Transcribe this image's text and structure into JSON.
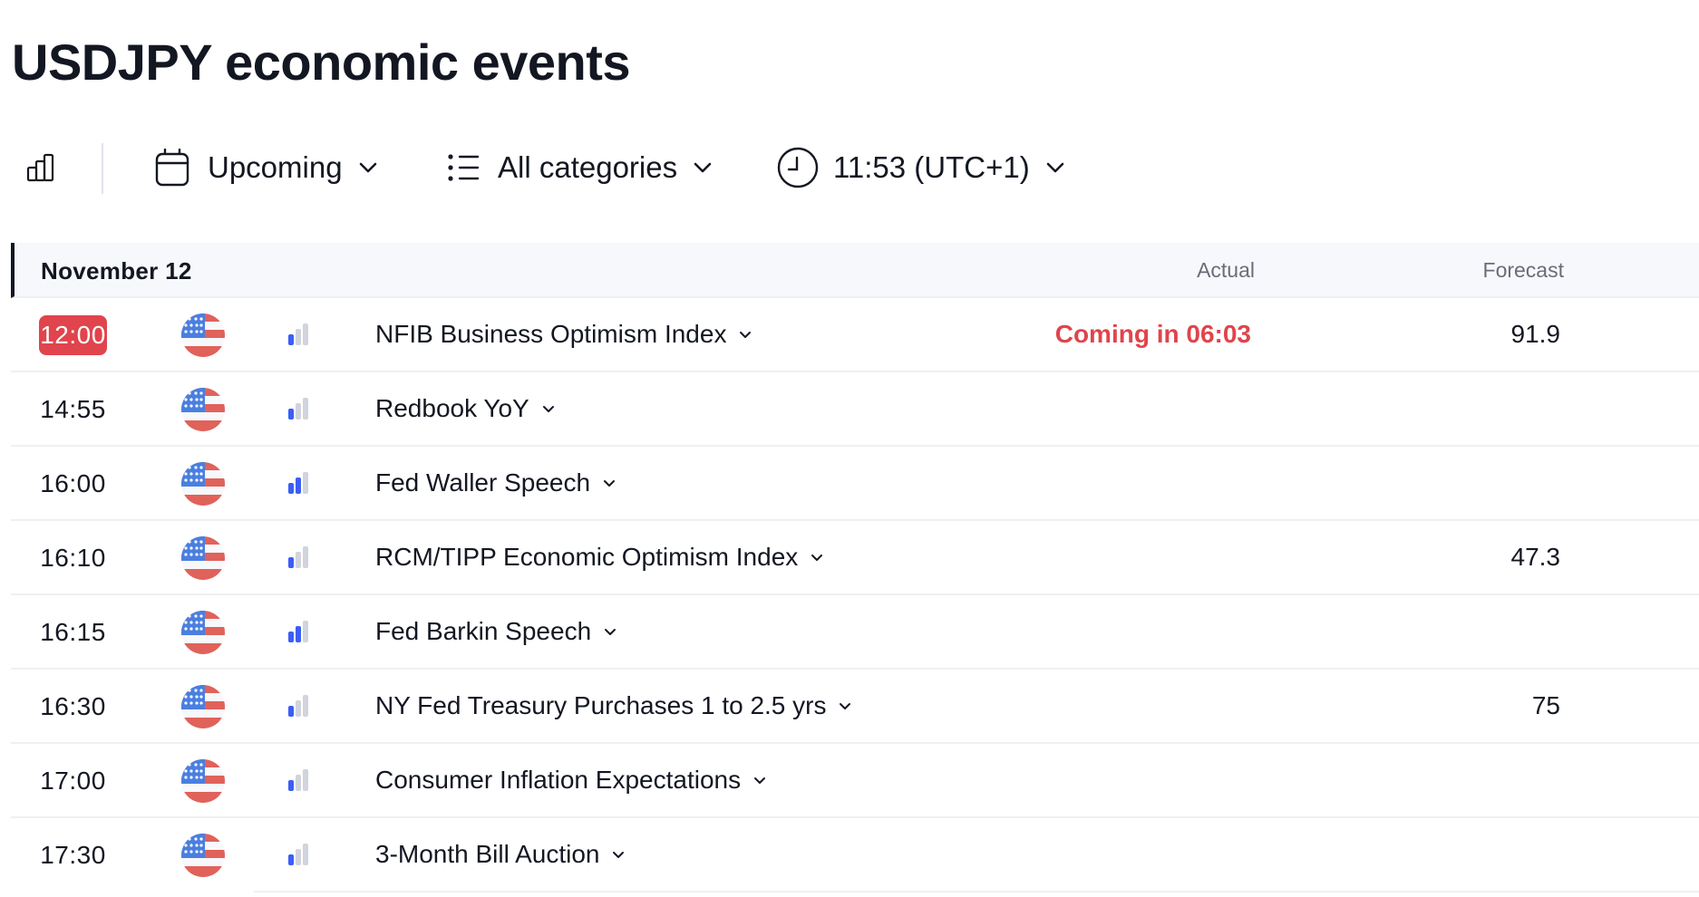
{
  "page": {
    "title": "USDJPY economic events"
  },
  "toolbar": {
    "importance_icon": "bar-chart-icon",
    "period": {
      "icon": "calendar-icon",
      "label": "Upcoming"
    },
    "categories": {
      "icon": "list-icon",
      "label": "All categories"
    },
    "timezone": {
      "icon": "clock-icon",
      "label": "11:53 (UTC+1)"
    }
  },
  "colors": {
    "accent_red": "#e0444c",
    "importance_active": "#3b5ef5",
    "importance_inactive": "#d1d4dc",
    "header_bg": "#f7f8fb"
  },
  "table": {
    "date": "November 12",
    "columns": {
      "actual": "Actual",
      "forecast": "Forecast"
    },
    "rows": [
      {
        "time": "12:00",
        "active": true,
        "country": "us-flag-icon",
        "importance": 1,
        "event": "NFIB Business Optimism Index",
        "actual": "Coming in 06:03",
        "actual_status": "coming",
        "forecast": "91.9"
      },
      {
        "time": "14:55",
        "active": false,
        "country": "us-flag-icon",
        "importance": 1,
        "event": "Redbook YoY",
        "actual": "",
        "actual_status": "",
        "forecast": ""
      },
      {
        "time": "16:00",
        "active": false,
        "country": "us-flag-icon",
        "importance": 2,
        "event": "Fed Waller Speech",
        "actual": "",
        "actual_status": "",
        "forecast": ""
      },
      {
        "time": "16:10",
        "active": false,
        "country": "us-flag-icon",
        "importance": 1,
        "event": "RCM/TIPP Economic Optimism Index",
        "actual": "",
        "actual_status": "",
        "forecast": "47.3"
      },
      {
        "time": "16:15",
        "active": false,
        "country": "us-flag-icon",
        "importance": 2,
        "event": "Fed Barkin Speech",
        "actual": "",
        "actual_status": "",
        "forecast": ""
      },
      {
        "time": "16:30",
        "active": false,
        "country": "us-flag-icon",
        "importance": 1,
        "event": "NY Fed Treasury Purchases 1 to 2.5 yrs",
        "actual": "",
        "actual_status": "",
        "forecast": "75"
      },
      {
        "time": "17:00",
        "active": false,
        "country": "us-flag-icon",
        "importance": 1,
        "event": "Consumer Inflation Expectations",
        "actual": "",
        "actual_status": "",
        "forecast": ""
      },
      {
        "time": "17:30",
        "active": false,
        "country": "us-flag-icon",
        "importance": 1,
        "event": "3-Month Bill Auction",
        "actual": "",
        "actual_status": "",
        "forecast": ""
      }
    ]
  }
}
